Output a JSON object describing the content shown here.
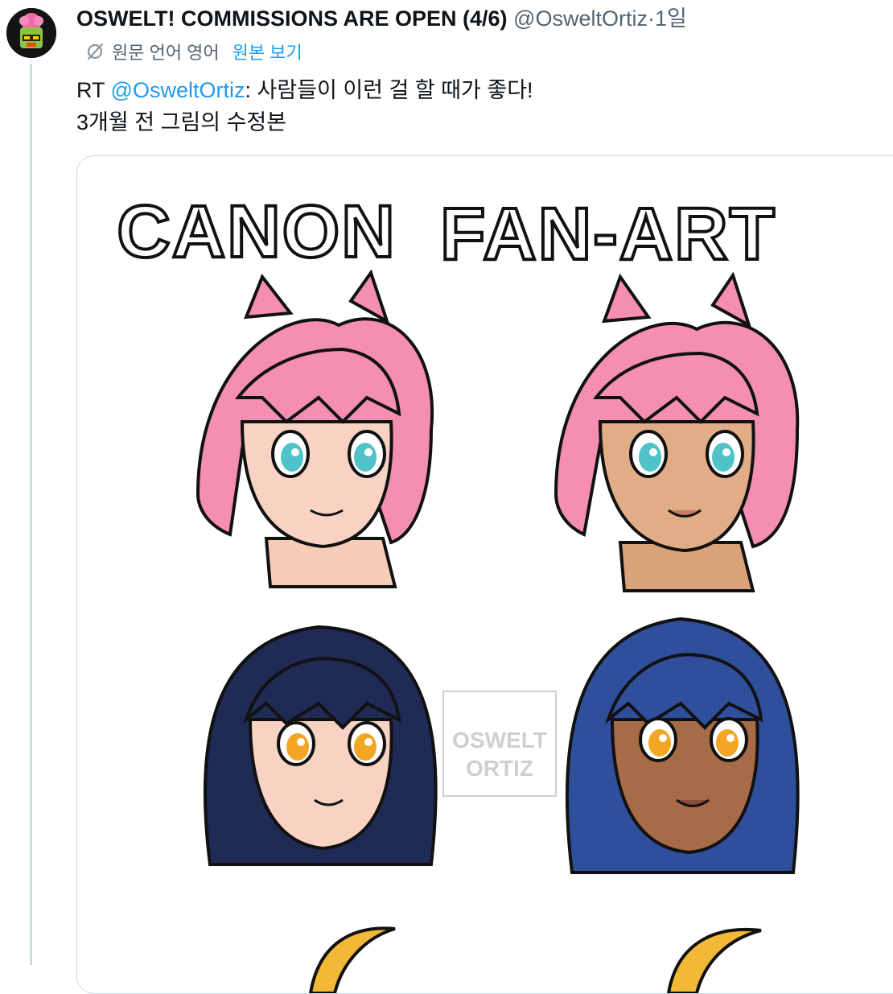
{
  "author": {
    "display_name": "OSWELT! COMMISSIONS ARE OPEN (4/6)",
    "handle": "@OsweltOrtiz",
    "separator": "·",
    "time": "1일"
  },
  "translation": {
    "icon": "translate-off-icon",
    "label": "원문 언어 영어",
    "show_original": "원본 보기"
  },
  "tweet": {
    "prefix": "RT ",
    "mention": "@OsweltOrtiz",
    "line1_rest": ": 사람들이 이런 걸 할 때가 좋다!",
    "line2": "3개월 전 그림의 수정본"
  },
  "media": {
    "label_left": "CANON",
    "label_right": "FAN-ART",
    "watermark_line1": "OSWELT",
    "watermark_line2": "ORTIZ"
  },
  "colors": {
    "accent": "#1d9bf0",
    "text": "#0f1419",
    "muted": "#536471",
    "pink_hair": "#f48fb1",
    "navy_hair": "#1f2a55",
    "blue_hair": "#2f4f9c",
    "teal_eyes": "#4fc3c8",
    "amber_eyes": "#f2a623"
  }
}
